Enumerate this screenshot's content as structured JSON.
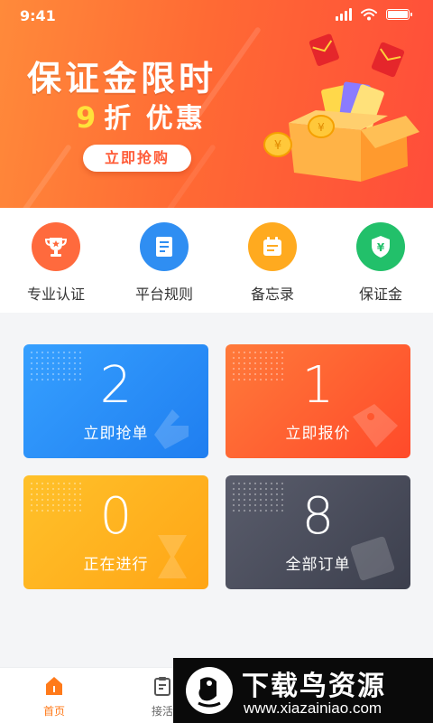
{
  "status_bar": {
    "time": "9:41"
  },
  "banner": {
    "title": "保证金限时",
    "sub_number": "9",
    "sub_text": "折 优惠",
    "button_label": "立即抢购",
    "colors": {
      "start": "#ff8a3a",
      "end": "#ff4d3a",
      "highlight": "#ffe23a"
    }
  },
  "quick_menu": [
    {
      "label": "专业认证",
      "icon": "trophy-icon",
      "color": "#ff6a3d"
    },
    {
      "label": "平台规则",
      "icon": "document-icon",
      "color": "#2f8ef2"
    },
    {
      "label": "备忘录",
      "icon": "memo-icon",
      "color": "#ffaa1f"
    },
    {
      "label": "保证金",
      "icon": "shield-yuan-icon",
      "color": "#22c06a"
    }
  ],
  "cards": [
    {
      "count": "2",
      "label": "立即抢单",
      "color": "#2a8cf7"
    },
    {
      "count": "1",
      "label": "立即报价",
      "color": "#ff5a2e"
    },
    {
      "count": "0",
      "label": "正在进行",
      "color": "#ffb018"
    },
    {
      "count": "8",
      "label": "全部订单",
      "color": "#4a4d5c"
    }
  ],
  "tab_bar": [
    {
      "label": "首页",
      "icon": "home-icon",
      "active": true
    },
    {
      "label": "接活",
      "icon": "clipboard-icon",
      "active": false
    }
  ],
  "watermark": {
    "title": "下载鸟资源",
    "url": "www.xiazainiao.com"
  }
}
